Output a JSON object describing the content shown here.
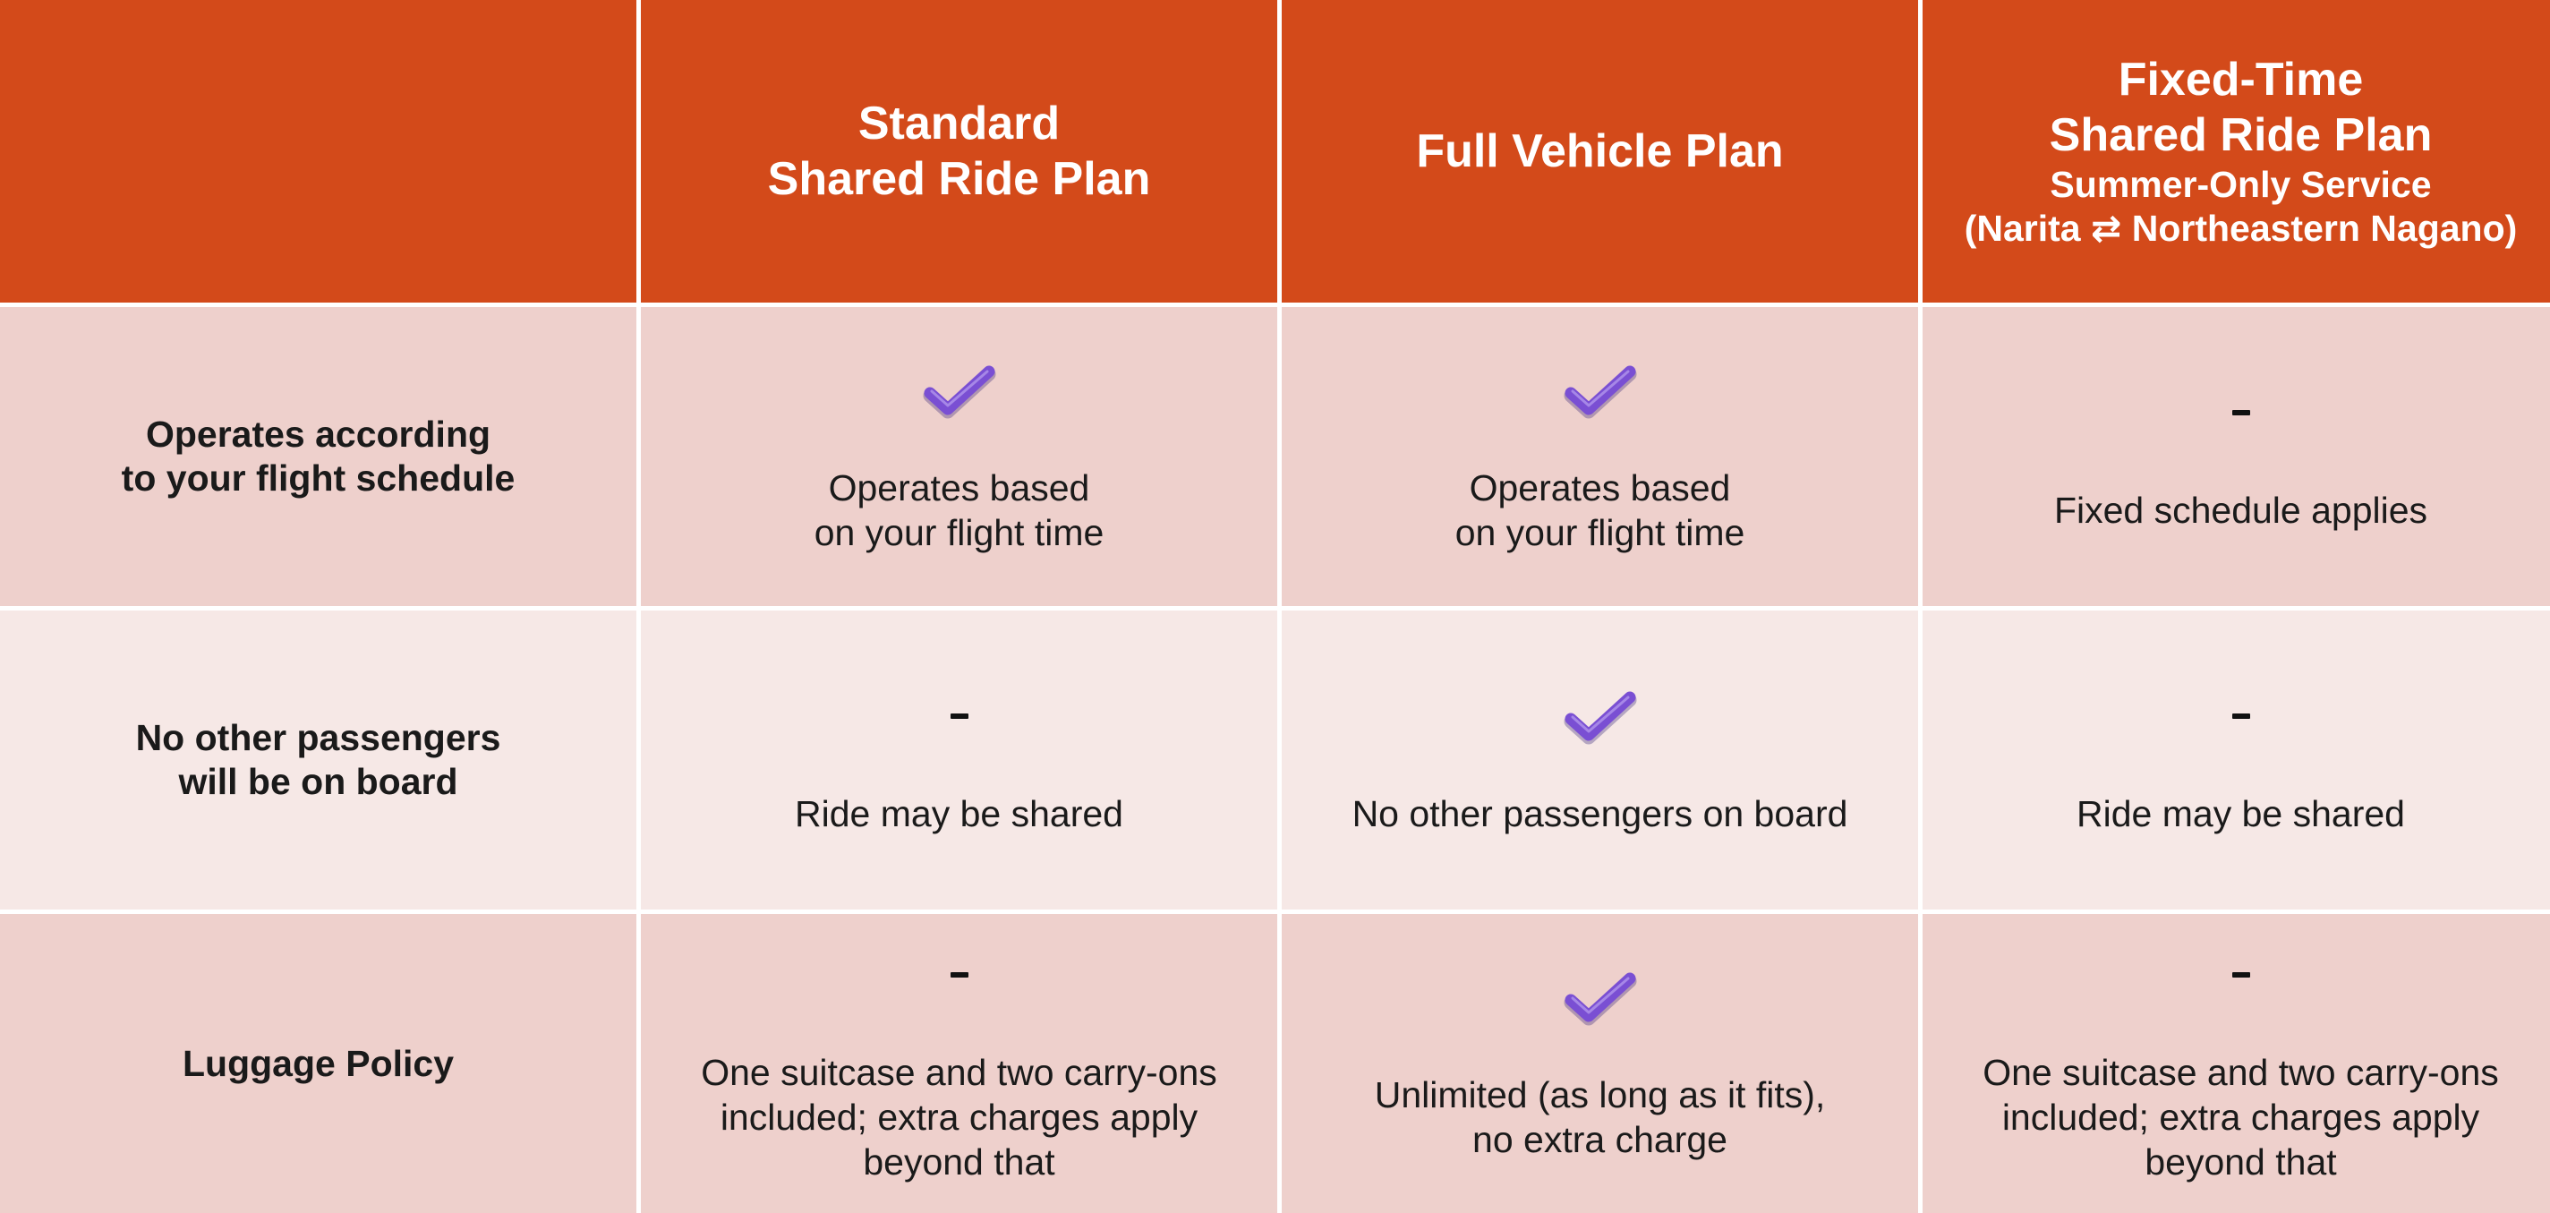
{
  "header": {
    "columns": [
      {
        "title": "",
        "subtitle": ""
      },
      {
        "title": "Standard\nShared Ride Plan",
        "subtitle": ""
      },
      {
        "title": "Full Vehicle Plan",
        "subtitle": ""
      },
      {
        "title": "Fixed-Time\nShared Ride Plan",
        "subtitle": "Summer-Only Service\n(Narita ⇄ Northeastern Nagano)"
      }
    ]
  },
  "rows": [
    {
      "label": "Operates according\nto your flight schedule",
      "cells": [
        {
          "mark": "check-icon",
          "text": "Operates based\non your flight time"
        },
        {
          "mark": "check-icon",
          "text": "Operates based\non your flight time"
        },
        {
          "mark": "dash-icon",
          "text": "Fixed schedule applies"
        }
      ]
    },
    {
      "label": "No other passengers\nwill be on board",
      "cells": [
        {
          "mark": "dash-icon",
          "text": "Ride may be shared"
        },
        {
          "mark": "check-icon",
          "text": "No other passengers on board"
        },
        {
          "mark": "dash-icon",
          "text": "Ride may be shared"
        }
      ]
    },
    {
      "label": "Luggage Policy",
      "cells": [
        {
          "mark": "dash-icon",
          "text": "One suitcase and two carry-ons\nincluded; extra charges apply\nbeyond that"
        },
        {
          "mark": "check-icon",
          "text": "Unlimited (as long as it fits),\nno extra charge"
        },
        {
          "mark": "dash-icon",
          "text": "One suitcase and two carry-ons\nincluded; extra charges apply\nbeyond that"
        }
      ]
    }
  ],
  "colors": {
    "header_bg": "#d34a1a",
    "header_text": "#ffffff",
    "row_dark": "#eed0cc",
    "row_light": "#f6e8e6",
    "check": "#7a4fd3"
  }
}
